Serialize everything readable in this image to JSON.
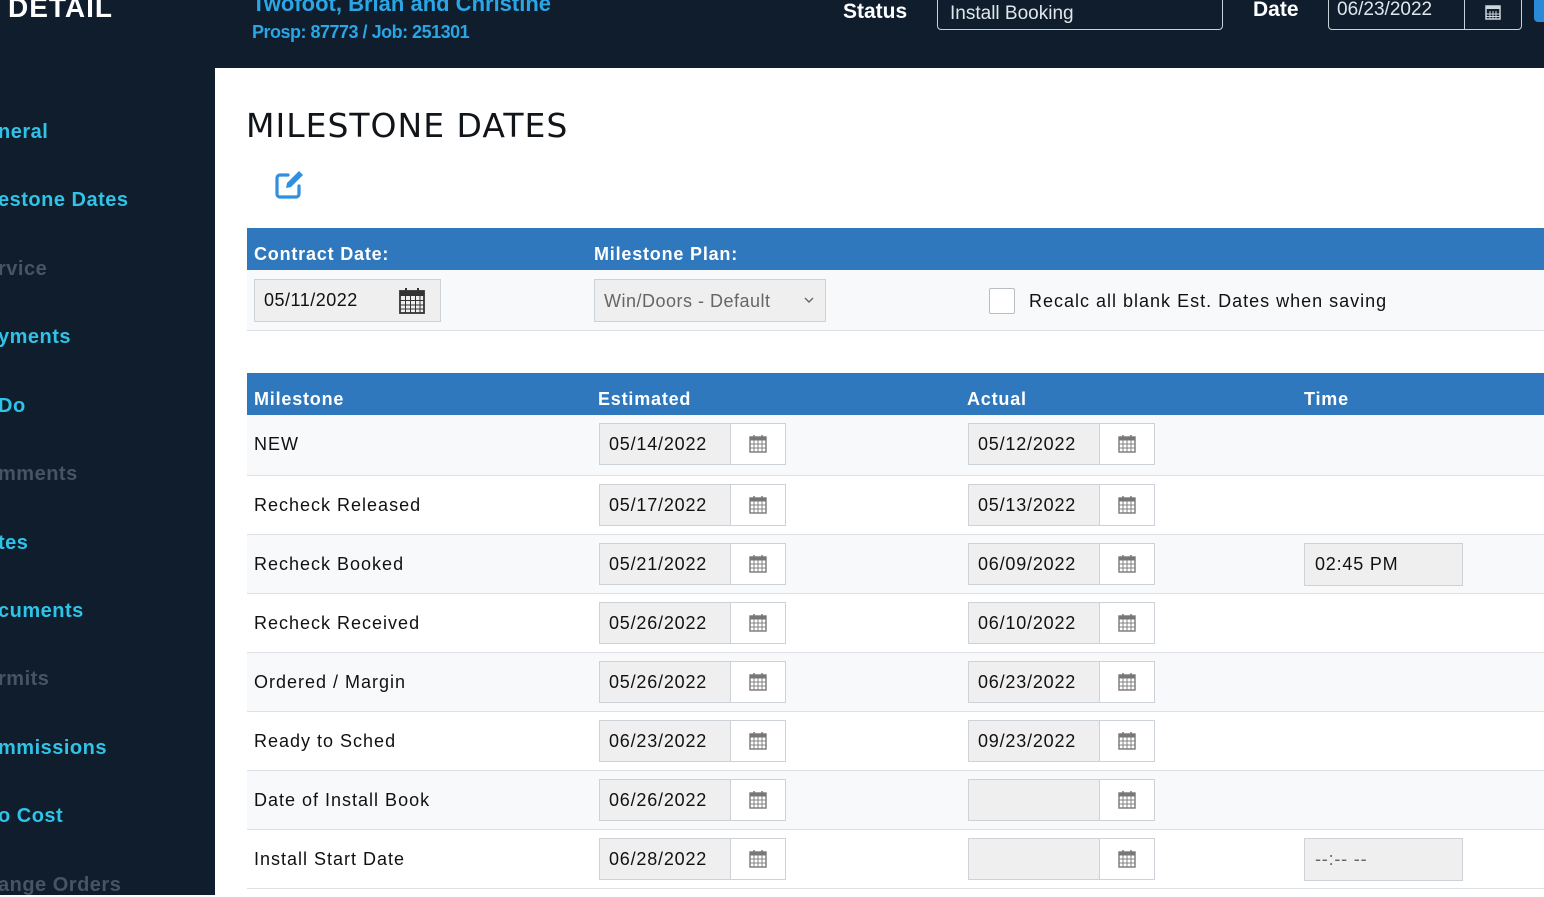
{
  "header": {
    "detail_title": "DETAIL",
    "customer_name": "Twofoot, Brian and Christine",
    "prosp_line": "Prosp: 87773 / Job: 251301",
    "status_label": "Status",
    "status_value": "Install Booking",
    "date_label": "Date",
    "date_value": "06/23/2022"
  },
  "sidebar": {
    "items": [
      {
        "label": "neral",
        "active": true
      },
      {
        "label": "estone Dates",
        "active": true
      },
      {
        "label": "rvice",
        "active": false
      },
      {
        "label": "yments",
        "active": true
      },
      {
        "label": "Do",
        "active": true
      },
      {
        "label": "mments",
        "active": false
      },
      {
        "label": "tes",
        "active": true
      },
      {
        "label": "cuments",
        "active": true
      },
      {
        "label": "rmits",
        "active": false
      },
      {
        "label": "mmissions",
        "active": true
      },
      {
        "label": "o Cost",
        "active": true
      },
      {
        "label": "ange Orders",
        "active": false
      }
    ]
  },
  "page": {
    "title": "MILESTONE DATES",
    "edit_icon": "edit-icon"
  },
  "contract": {
    "contract_date_label": "Contract Date:",
    "milestone_plan_label": "Milestone Plan:",
    "contract_date_value": "05/11/2022",
    "milestone_plan_value": "Win/Doors - Default",
    "recalc_label": "Recalc all blank Est. Dates when saving",
    "recalc_checked": false
  },
  "table": {
    "headers": {
      "milestone": "Milestone",
      "estimated": "Estimated",
      "actual": "Actual",
      "time": "Time"
    },
    "rows": [
      {
        "milestone": "NEW",
        "estimated": "05/14/2022",
        "actual": "05/12/2022",
        "time": null
      },
      {
        "milestone": "Recheck Released",
        "estimated": "05/17/2022",
        "actual": "05/13/2022",
        "time": null
      },
      {
        "milestone": "Recheck Booked",
        "estimated": "05/21/2022",
        "actual": "06/09/2022",
        "time": "02:45 PM"
      },
      {
        "milestone": "Recheck Received",
        "estimated": "05/26/2022",
        "actual": "06/10/2022",
        "time": null
      },
      {
        "milestone": "Ordered / Margin",
        "estimated": "05/26/2022",
        "actual": "06/23/2022",
        "time": null
      },
      {
        "milestone": "Ready to Sched",
        "estimated": "06/23/2022",
        "actual": "09/23/2022",
        "time": null
      },
      {
        "milestone": "Date of Install Book",
        "estimated": "06/26/2022",
        "actual": "",
        "time": null
      },
      {
        "milestone": "Install Start Date",
        "estimated": "06/28/2022",
        "actual": "",
        "time": "--:-- --"
      }
    ]
  },
  "colors": {
    "dark_bg": "#0f1d2c",
    "accent_blue": "#3078bd",
    "sidebar_text": "#2fc3e8",
    "sidebar_muted": "#465464",
    "link_blue": "#2aa6e6"
  }
}
